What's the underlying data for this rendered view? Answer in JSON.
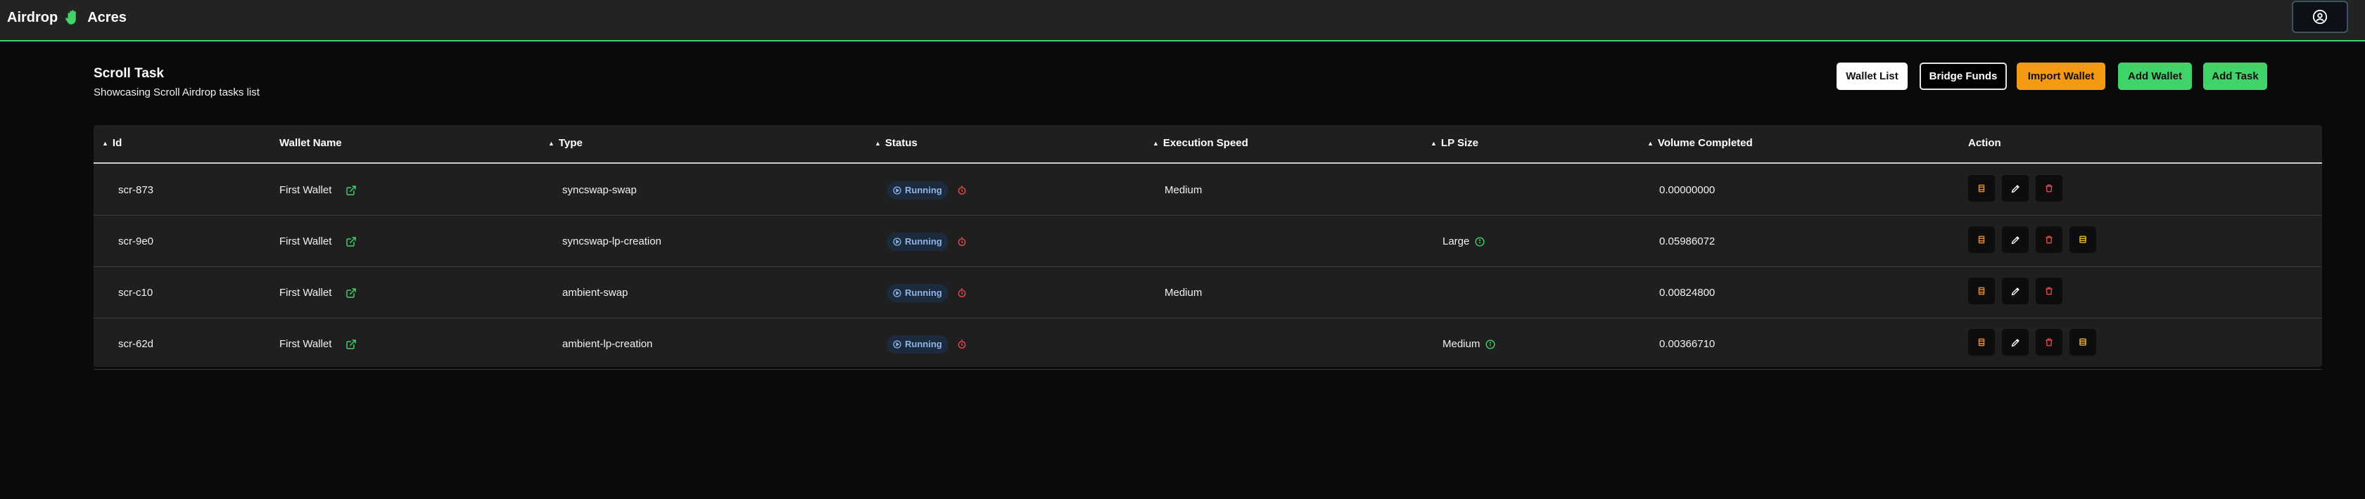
{
  "app": {
    "brand_left": "Airdrop",
    "brand_right": "Acres"
  },
  "header": {
    "title": "Scroll Task",
    "subtitle": "Showcasing Scroll Airdrop tasks list"
  },
  "toolbar": {
    "wallet_list": "Wallet List",
    "bridge_funds": "Bridge Funds",
    "import_wallet": "Import Wallet",
    "add_wallet": "Add Wallet",
    "add_task": "Add Task"
  },
  "colors": {
    "accent": "#3fd36a",
    "warning": "#f49a12",
    "danger": "#e5484d",
    "running": "#8fb5e8"
  },
  "table": {
    "columns": {
      "id": "Id",
      "wallet_name": "Wallet Name",
      "type": "Type",
      "status": "Status",
      "execution_speed": "Execution Speed",
      "lp_size": "LP Size",
      "volume_completed": "Volume Completed",
      "action": "Action"
    },
    "rows": [
      {
        "id": "scr-873",
        "wallet": "First Wallet",
        "type": "syncswap-swap",
        "status": "Running",
        "speed": "Medium",
        "lp_size": "",
        "volume": "0.00000000",
        "has_fourth_action": false
      },
      {
        "id": "scr-9e0",
        "wallet": "First Wallet",
        "type": "syncswap-lp-creation",
        "status": "Running",
        "speed": "",
        "lp_size": "Large",
        "volume": "0.05986072",
        "has_fourth_action": true
      },
      {
        "id": "scr-c10",
        "wallet": "First Wallet",
        "type": "ambient-swap",
        "status": "Running",
        "speed": "Medium",
        "lp_size": "",
        "volume": "0.00824800",
        "has_fourth_action": false
      },
      {
        "id": "scr-62d",
        "wallet": "First Wallet",
        "type": "ambient-lp-creation",
        "status": "Running",
        "speed": "",
        "lp_size": "Medium",
        "volume": "0.00366710",
        "has_fourth_action": true
      }
    ]
  }
}
